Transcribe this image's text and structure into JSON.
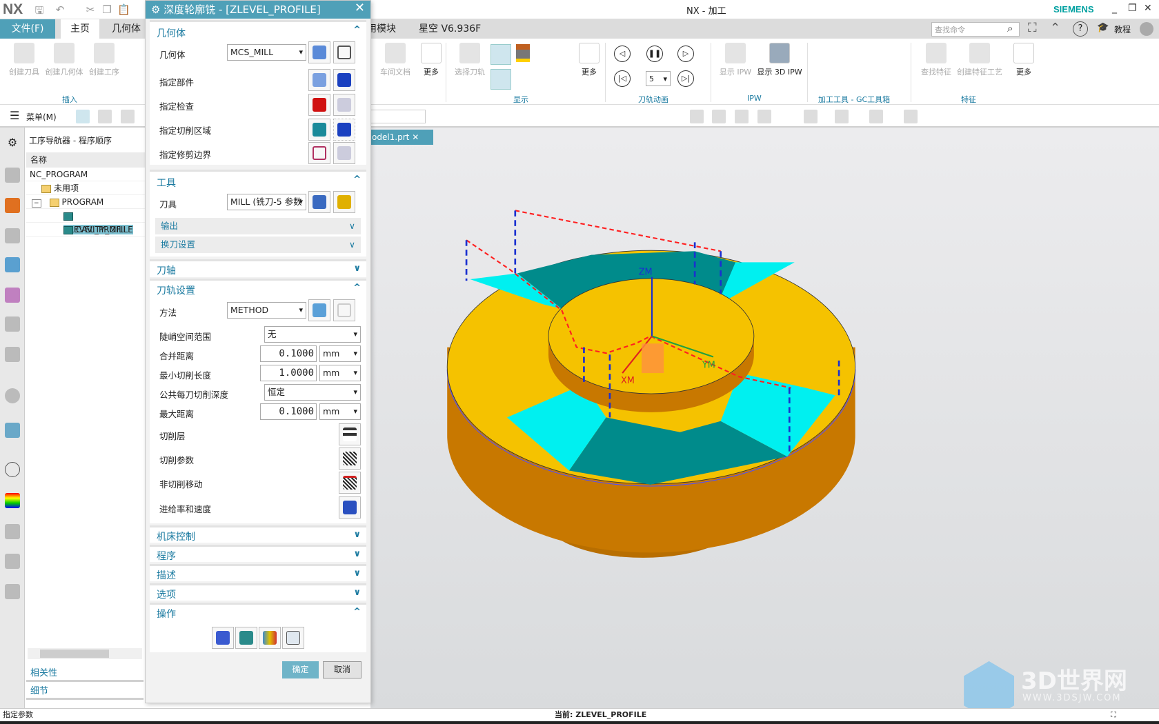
{
  "titlebar": {
    "logo": "NX",
    "title": "NX - 加工",
    "brand": "SIEMENS",
    "minimize": "_",
    "restore": "❐",
    "close": "✕"
  },
  "tabs": [
    "文件(F)",
    "主页",
    "几何体",
    "用模块",
    "星空 V6.936F"
  ],
  "search": {
    "placeholder": "查找命令"
  },
  "help": {
    "tutorial": "教程"
  },
  "ribbon": {
    "buttons": [
      "创建刀具",
      "创建几何体",
      "创建工序",
      "车间文档",
      "更多",
      "选择刀轨",
      "更多",
      "显示 IPW",
      "显示 3D IPW",
      "查找特征",
      "创建特征工艺",
      "更多"
    ],
    "groups": [
      "插入",
      "显示",
      "刀轨动画",
      "IPW",
      "加工工具 - GC工具箱",
      "特征"
    ],
    "animation_speed": "5"
  },
  "toolbar": {
    "menu": "菜单(M)"
  },
  "navigator": {
    "title": "工序导航器 - 程序顺序",
    "column": "名称",
    "rows": [
      {
        "label": "NC_PROGRAM",
        "level": 0
      },
      {
        "label": "未用项",
        "level": 1
      },
      {
        "label": "PROGRAM",
        "level": 1
      },
      {
        "label": "ZLEVEL_PROFILE",
        "level": 2,
        "selected": true
      },
      {
        "label": "CAVITY_MILL",
        "level": 2
      }
    ],
    "panels": [
      "相关性",
      "细节"
    ]
  },
  "dialog": {
    "title": "深度轮廓铣 - [ZLEVEL_PROFILE]",
    "geometry": {
      "header": "几何体",
      "geometry_label": "几何体",
      "geometry_value": "MCS_MILL",
      "part": "指定部件",
      "check": "指定检查",
      "cut_area": "指定切削区域",
      "trim": "指定修剪边界"
    },
    "tool": {
      "header": "工具",
      "tool_label": "刀具",
      "tool_value": "MILL (铣刀-5 参数",
      "output": "输出",
      "tool_change": "换刀设置"
    },
    "axis": {
      "header": "刀轴"
    },
    "path": {
      "header": "刀轨设置",
      "method_label": "方法",
      "method_value": "METHOD",
      "steep_label": "陡峭空间范围",
      "steep_value": "无",
      "merge_label": "合并距离",
      "merge_value": "0.1000",
      "merge_unit": "mm",
      "mincut_label": "最小切削长度",
      "mincut_value": "1.0000",
      "mincut_unit": "mm",
      "depth_label": "公共每刀切削深度",
      "depth_value": "恒定",
      "maxdist_label": "最大距离",
      "maxdist_value": "0.1000",
      "maxdist_unit": "mm",
      "cut_levels": "切削层",
      "cut_params": "切削参数",
      "non_cut": "非切削移动",
      "feeds": "进给率和速度"
    },
    "collapsed": [
      "机床控制",
      "程序",
      "描述",
      "选项"
    ],
    "actions": {
      "header": "操作"
    },
    "ok": "确定",
    "cancel": "取消"
  },
  "viewport": {
    "tab": "odel1.prt",
    "axes": {
      "z": "ZM",
      "y": "YM",
      "x": "XM"
    },
    "colors": {
      "top": "#f5c200",
      "side": "#c87800",
      "slot": "#008b8b",
      "ramp": "#00f0f0",
      "path": "#ff2020",
      "engage": "#1a30d0"
    }
  },
  "watermark": {
    "text": "3D世界网",
    "url": "WWW.3DSJW.COM"
  },
  "status": {
    "left": "指定参数",
    "center": "当前: ZLEVEL_PROFILE"
  }
}
